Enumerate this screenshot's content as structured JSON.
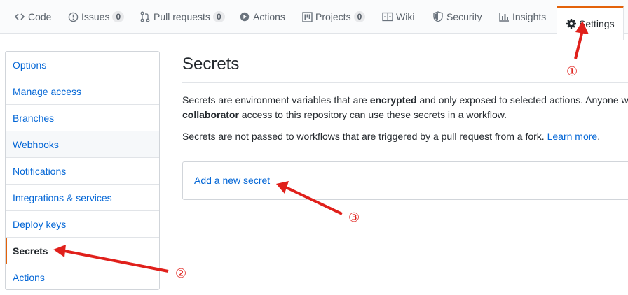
{
  "tabs": [
    {
      "id": "code",
      "label": "Code",
      "icon": "code-icon"
    },
    {
      "id": "issues",
      "label": "Issues",
      "icon": "issue-icon",
      "count": "0"
    },
    {
      "id": "pulls",
      "label": "Pull requests",
      "icon": "pull-request-icon",
      "count": "0"
    },
    {
      "id": "actions",
      "label": "Actions",
      "icon": "play-icon"
    },
    {
      "id": "projects",
      "label": "Projects",
      "icon": "project-icon",
      "count": "0"
    },
    {
      "id": "wiki",
      "label": "Wiki",
      "icon": "book-icon"
    },
    {
      "id": "security",
      "label": "Security",
      "icon": "shield-icon"
    },
    {
      "id": "insights",
      "label": "Insights",
      "icon": "graph-icon"
    },
    {
      "id": "settings",
      "label": "Settings",
      "icon": "gear-icon",
      "selected": true
    }
  ],
  "menu": {
    "items": [
      {
        "label": "Options"
      },
      {
        "label": "Manage access"
      },
      {
        "label": "Branches"
      },
      {
        "label": "Webhooks"
      },
      {
        "label": "Notifications"
      },
      {
        "label": "Integrations & services"
      },
      {
        "label": "Deploy keys"
      },
      {
        "label": "Secrets"
      },
      {
        "label": "Actions"
      }
    ],
    "selected": "Secrets",
    "hovered": "Webhooks"
  },
  "main": {
    "title": "Secrets",
    "para1": {
      "part1": "Secrets are environment variables that are ",
      "bold1": "encrypted",
      "part2": " and only exposed to selected actions. Anyone w",
      "bold2": "collaborator",
      "part3": " access to this repository can use these secrets in a workflow."
    },
    "para2": {
      "text": "Secrets are not passed to workflows that are triggered by a pull request from a fork. ",
      "link": "Learn more",
      "end": "."
    },
    "add_secret_label": "Add a new secret"
  },
  "annotations": {
    "step1": "①",
    "step2": "②",
    "step3": "③",
    "color": "#e0201b"
  },
  "colors": {
    "accent": "#e36209",
    "link": "#0366d6"
  }
}
